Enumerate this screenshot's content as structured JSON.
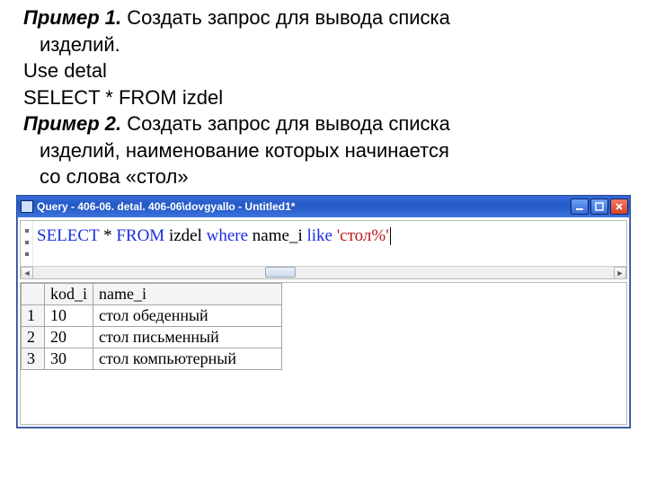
{
  "text": {
    "ex1_label": "Пример 1.",
    "ex1_tail": " Создать запрос для вывода списка",
    "ex1_line2": "изделий.",
    "use_line": "Use detal",
    "select_line": "SELECT * FROM izdel",
    "ex2_label": "Пример 2.",
    "ex2_tail": " Создать запрос для вывода списка",
    "ex2_line2": "изделий, наименование которых начинается",
    "ex2_line3": "со слова «стол»"
  },
  "window": {
    "title": "Query - 406-06. detal. 406-06\\dovgyallo - Untitled1*"
  },
  "sql": {
    "kw1": "SELECT",
    "star": " * ",
    "kw2": "FROM",
    "tbl": " izdel ",
    "kw3": "where",
    "col": " name_i ",
    "kw4": "like",
    "sp": " ",
    "str": "'стол%'"
  },
  "grid": {
    "headers": [
      "kod_i",
      "name_i"
    ],
    "rows": [
      {
        "n": "1",
        "kod_i": "10",
        "name_i": "стол обеденный"
      },
      {
        "n": "2",
        "kod_i": "20",
        "name_i": "стол письменный"
      },
      {
        "n": "3",
        "kod_i": "30",
        "name_i": "стол компьютерный"
      }
    ]
  }
}
